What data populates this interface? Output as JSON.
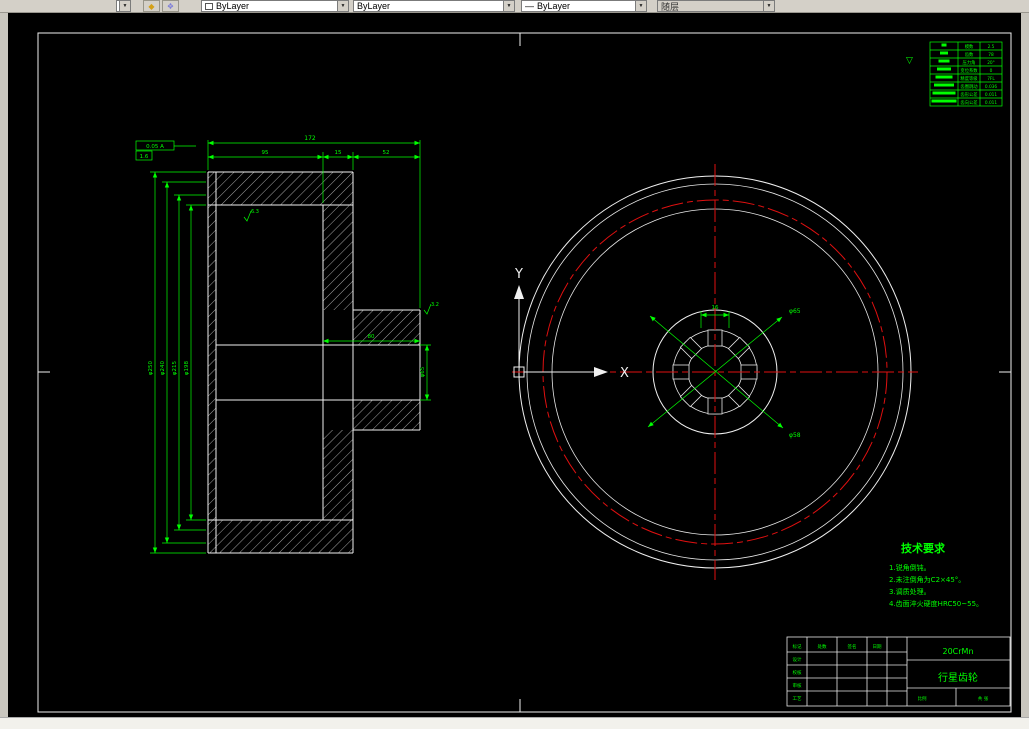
{
  "toolbar": {
    "combo_color": "ByLayer",
    "combo_linetype": "ByLayer",
    "combo_lineweight": "ByLayer",
    "combo_plotstyle": "随层",
    "arrow_glyph": "▼",
    "line_glyph": "—",
    "swatch_color": "background:#ffffff",
    "icon1": "◆",
    "icon2": "❖"
  },
  "ucs": {
    "x_label": "X",
    "y_label": "Y"
  },
  "left_view": {
    "dim_overall": "172",
    "dim_a": "95",
    "dim_b": "15",
    "dim_c": "52",
    "dia_1": "φ250",
    "dia_2": "φ240",
    "dia_3": "φ215",
    "dia_4": "φ198",
    "hub_len": "80",
    "bore_dia": "φ65",
    "rough_1": "6.3",
    "rough_2": "3.2",
    "frame_tol": "0.05 A",
    "frame_val": "1.6"
  },
  "right_view": {
    "dia_1": "φ65",
    "dia_2": "φ58",
    "dim_top": "16"
  },
  "surface_mark": "▽",
  "gear_table": {
    "rows": [
      [
        "模数",
        "2.5"
      ],
      [
        "齿数",
        "78"
      ],
      [
        "压力角",
        "20°"
      ],
      [
        "变位系数",
        "0"
      ],
      [
        "精度等级",
        "7FL"
      ],
      [
        "齿圈跳动",
        "0.036"
      ],
      [
        "齿形公差",
        "0.011"
      ],
      [
        "齿向公差",
        "0.011"
      ]
    ]
  },
  "tech_req": {
    "title": "技术要求",
    "items": [
      "1.锐角倒钝。",
      "2.未注倒角为C2×45°。",
      "3.调质处理。",
      "4.齿面淬火硬度HRC50~55。"
    ]
  },
  "title_block": {
    "material": "20CrMn",
    "part_name": "行星齿轮",
    "labels": [
      "标记",
      "处数",
      "签名",
      "日期",
      "设计",
      "校核",
      "审核",
      "工艺",
      "比例",
      "共 张"
    ]
  }
}
